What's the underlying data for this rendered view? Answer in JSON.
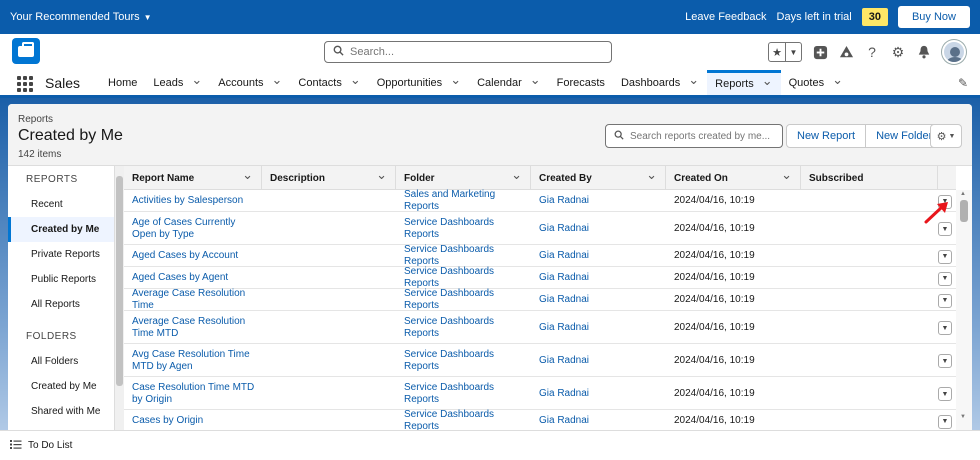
{
  "trial_bar": {
    "tours_label": "Your Recommended Tours",
    "leave_feedback": "Leave Feedback",
    "days_left_label": "Days left in trial",
    "days_left_count": "30",
    "buy_now": "Buy Now"
  },
  "header": {
    "search_placeholder": "Search..."
  },
  "nav": {
    "app_name": "Sales",
    "items": [
      {
        "label": "Home",
        "chev": false
      },
      {
        "label": "Leads",
        "chev": true
      },
      {
        "label": "Accounts",
        "chev": true
      },
      {
        "label": "Contacts",
        "chev": true
      },
      {
        "label": "Opportunities",
        "chev": true
      },
      {
        "label": "Calendar",
        "chev": true
      },
      {
        "label": "Forecasts",
        "chev": false
      },
      {
        "label": "Dashboards",
        "chev": true
      },
      {
        "label": "Reports",
        "chev": true,
        "active": true
      },
      {
        "label": "Quotes",
        "chev": true
      }
    ]
  },
  "page": {
    "breadcrumb": "Reports",
    "title": "Created by Me",
    "item_count": "142 items",
    "search_placeholder": "Search reports created by me...",
    "new_report": "New Report",
    "new_folder": "New Folder"
  },
  "sidebar": {
    "reports_heading": "REPORTS",
    "reports_items": [
      "Recent",
      "Created by Me",
      "Private Reports",
      "Public Reports",
      "All Reports"
    ],
    "folders_heading": "FOLDERS",
    "folders_items": [
      "All Folders",
      "Created by Me",
      "Shared with Me"
    ]
  },
  "table": {
    "columns": [
      "Report Name",
      "Description",
      "Folder",
      "Created By",
      "Created On",
      "Subscribed"
    ],
    "rows": [
      {
        "name": "Activities by Salesperson",
        "description": "",
        "folder": "Sales and Marketing Reports",
        "created_by": "Gia Radnai",
        "created_on": "2024/04/16, 10:19",
        "subscribed": ""
      },
      {
        "name": "Age of Cases Currently Open by Type",
        "description": "",
        "folder": "Service Dashboards Reports",
        "created_by": "Gia Radnai",
        "created_on": "2024/04/16, 10:19",
        "subscribed": ""
      },
      {
        "name": "Aged Cases by Account",
        "description": "",
        "folder": "Service Dashboards Reports",
        "created_by": "Gia Radnai",
        "created_on": "2024/04/16, 10:19",
        "subscribed": ""
      },
      {
        "name": "Aged Cases by Agent",
        "description": "",
        "folder": "Service Dashboards Reports",
        "created_by": "Gia Radnai",
        "created_on": "2024/04/16, 10:19",
        "subscribed": ""
      },
      {
        "name": "Average Case Resolution Time",
        "description": "",
        "folder": "Service Dashboards Reports",
        "created_by": "Gia Radnai",
        "created_on": "2024/04/16, 10:19",
        "subscribed": ""
      },
      {
        "name": "Average Case Resolution Time MTD",
        "description": "",
        "folder": "Service Dashboards Reports",
        "created_by": "Gia Radnai",
        "created_on": "2024/04/16, 10:19",
        "subscribed": ""
      },
      {
        "name": "Avg Case Resolution Time MTD by Agen",
        "description": "",
        "folder": "Service Dashboards Reports",
        "created_by": "Gia Radnai",
        "created_on": "2024/04/16, 10:19",
        "subscribed": ""
      },
      {
        "name": "Case Resolution Time MTD by Origin",
        "description": "",
        "folder": "Service Dashboards Reports",
        "created_by": "Gia Radnai",
        "created_on": "2024/04/16, 10:19",
        "subscribed": ""
      },
      {
        "name": "Cases by Origin",
        "description": "",
        "folder": "Service Dashboards Reports",
        "created_by": "Gia Radnai",
        "created_on": "2024/04/16, 10:19",
        "subscribed": ""
      }
    ]
  },
  "footer": {
    "todo_label": "To Do List"
  },
  "colors": {
    "brand_blue": "#0b5cab",
    "link_blue": "#0b5cab",
    "annotation_arrow": "#e8151b"
  }
}
